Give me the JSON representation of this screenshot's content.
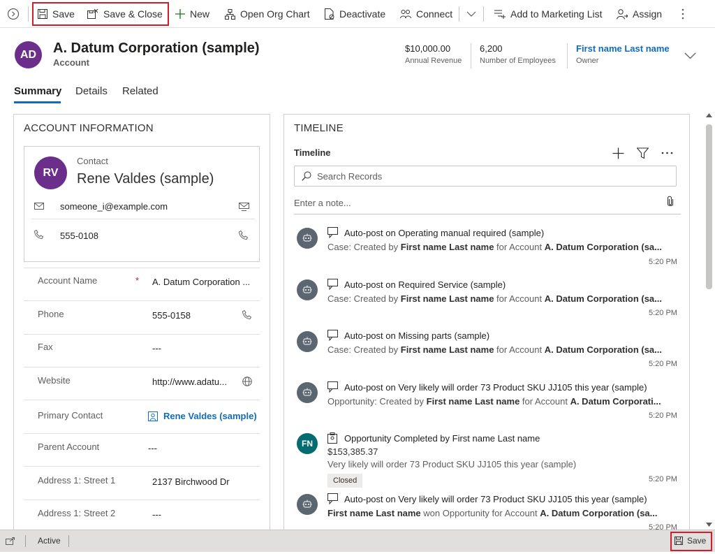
{
  "command_bar": {
    "save_label": "Save",
    "save_close_label": "Save & Close",
    "new_label": "New",
    "org_chart_label": "Open Org Chart",
    "deactivate_label": "Deactivate",
    "connect_label": "Connect",
    "marketing_label": "Add to Marketing List",
    "assign_label": "Assign"
  },
  "header": {
    "avatar_initials": "AD",
    "avatar_color": "#6b2e8b",
    "title": "A. Datum Corporation (sample)",
    "entity": "Account",
    "annual_revenue_value": "$10,000.00",
    "annual_revenue_label": "Annual Revenue",
    "employees_value": "6,200",
    "employees_label": "Number of Employees",
    "owner_value": "First name Last name",
    "owner_label": "Owner"
  },
  "tabs": [
    "Summary",
    "Details",
    "Related"
  ],
  "account_info": {
    "section_title": "ACCOUNT INFORMATION",
    "contact": {
      "initials": "RV",
      "avatar_color": "#6b2e8b",
      "caption": "Contact",
      "name": "Rene Valdes (sample)",
      "email": "someone_i@example.com",
      "phone": "555-0108"
    },
    "fields": [
      {
        "label": "Account Name",
        "value": "A. Datum Corporation ..."
      },
      {
        "label": "Phone",
        "value": "555-0158"
      },
      {
        "label": "Fax",
        "value": "---"
      },
      {
        "label": "Website",
        "value": "http://www.adatu..."
      },
      {
        "label": "Primary Contact",
        "value": "Rene Valdes (sample)"
      },
      {
        "label": "Parent Account",
        "value": "---"
      },
      {
        "label": "Address 1: Street 1",
        "value": "2137 Birchwood Dr"
      },
      {
        "label": "Address 1: Street 2",
        "value": "---"
      }
    ]
  },
  "timeline": {
    "section_title": "TIMELINE",
    "subtitle": "Timeline",
    "search_placeholder": "Search Records",
    "note_placeholder": "Enter a note...",
    "items": [
      {
        "title": "Auto-post on Operating manual required (sample)",
        "desc_prefix": "Case: Created by ",
        "desc_user": "First name Last name",
        "desc_mid": " for Account ",
        "desc_account": "A. Datum Corporation (sa...",
        "time": "5:20 PM"
      },
      {
        "title": "Auto-post on Required Service (sample)",
        "desc_prefix": "Case: Created by ",
        "desc_user": "First name Last name",
        "desc_mid": " for Account ",
        "desc_account": "A. Datum Corporation (sa...",
        "time": "5:20 PM"
      },
      {
        "title": "Auto-post on Missing parts (sample)",
        "desc_prefix": "Case: Created by ",
        "desc_user": "First name Last name",
        "desc_mid": " for Account ",
        "desc_account": "A. Datum Corporation (sa...",
        "time": "5:20 PM"
      },
      {
        "title": "Auto-post on Very likely will order 73 Product SKU JJ105 this year (sample)",
        "desc_prefix": "Opportunity: Created by ",
        "desc_user": "First name Last name",
        "desc_mid": " for Account ",
        "desc_account": "A. Datum Corporati...",
        "time": "5:20 PM"
      },
      {
        "title": "Opportunity Completed by First name Last name",
        "amount": "$153,385.37",
        "detail": "Very likely will order 73 Product SKU JJ105 this year (sample)",
        "badge": "Closed",
        "initials": "FN",
        "avatar_color": "#036c70",
        "time": "5:20 PM"
      },
      {
        "title": "Auto-post on Very likely will order 73 Product SKU JJ105 this year (sample)",
        "desc_user": "First name Last name",
        "desc_mid": " won Opportunity for Account ",
        "desc_account": "A. Datum Corporation (sa...",
        "time": "5:20 PM"
      }
    ]
  },
  "status_bar": {
    "status": "Active",
    "save_label": "Save"
  }
}
